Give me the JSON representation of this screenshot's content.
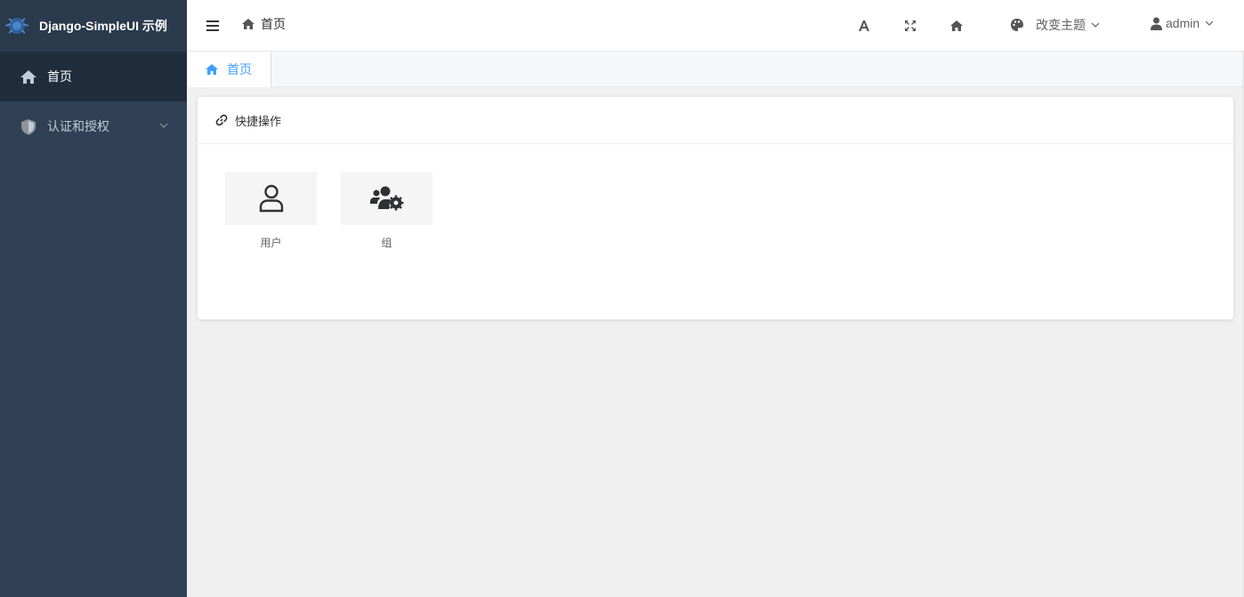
{
  "app": {
    "title": "Django-SimpleUI 示例"
  },
  "sidebar": {
    "items": [
      {
        "label": "首页",
        "icon": "home-icon",
        "active": true
      },
      {
        "label": "认证和授权",
        "icon": "shield-icon",
        "expandable": true
      }
    ]
  },
  "header": {
    "breadcrumb": "首页",
    "theme_label": "改变主题",
    "user_name": "admin",
    "buttons": [
      "font-size-icon",
      "fullscreen-icon",
      "home-icon"
    ]
  },
  "tabs": [
    {
      "label": "首页",
      "active": true
    }
  ],
  "card": {
    "title": "快捷操作",
    "items": [
      {
        "label": "用户",
        "icon": "user-icon"
      },
      {
        "label": "组",
        "icon": "users-cog-icon"
      }
    ]
  },
  "colors": {
    "sidebar_bg": "#304156",
    "sidebar_active_bg": "#1f2d3d",
    "accent": "#409eff"
  }
}
